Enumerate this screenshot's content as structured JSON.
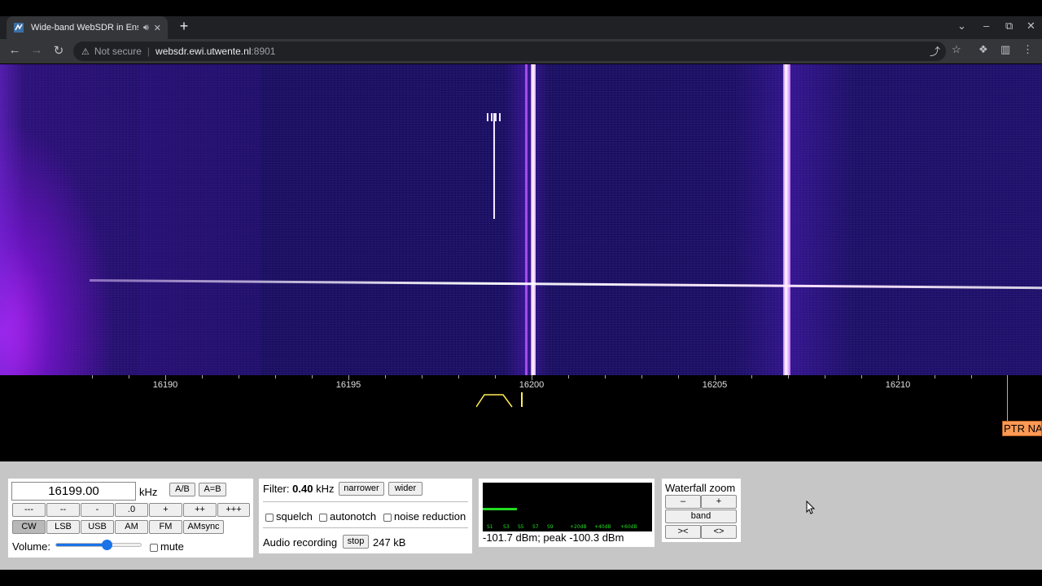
{
  "browser": {
    "tab_title": "Wide-band WebSDR in Ensch",
    "new_tab_label": "+",
    "security_label": "Not secure",
    "url_host": "websdr.ewi.utwente.nl",
    "url_port": ":8901"
  },
  "scale": {
    "labels": [
      {
        "text": "16190",
        "khz": 16190
      },
      {
        "text": "16195",
        "khz": 16195
      },
      {
        "text": "16200",
        "khz": 16200
      },
      {
        "text": "16205",
        "khz": 16205
      },
      {
        "text": "16210",
        "khz": 16210
      }
    ],
    "marker_label": "PTR NA"
  },
  "frequency": {
    "value": "16199.00",
    "unit": "kHz",
    "ab_label": "A/B",
    "a_eq_b_label": "A=B",
    "step_buttons": [
      "---",
      "--",
      "-",
      ".0",
      "+",
      "++",
      "+++"
    ],
    "modes": [
      "CW",
      "LSB",
      "USB",
      "AM",
      "FM",
      "AMsync"
    ],
    "active_mode": "CW",
    "volume_label": "Volume:",
    "volume_level": 0.6,
    "mute_label": "mute"
  },
  "filter": {
    "label": "Filter:",
    "value": "0.40",
    "unit": "kHz",
    "narrower_label": "narrower",
    "wider_label": "wider",
    "squelch_label": "squelch",
    "autonotch_label": "autonotch",
    "noise_reduction_label": "noise reduction",
    "recording_label": "Audio recording",
    "stop_label": "stop",
    "recording_size": "247 kB"
  },
  "smeter": {
    "reading": "-101.7 dBm; peak -100.3 dBm",
    "scale_labels": [
      "S1",
      "S3",
      "S5",
      "S7",
      "S9",
      "+20dB",
      "+40dB",
      "+60dB"
    ],
    "level": 0.2
  },
  "waterfall_zoom": {
    "title": "Waterfall zoom",
    "minus_label": "–",
    "plus_label": "+",
    "band_label": "band",
    "narrow_label": "><",
    "wide_label": "<>"
  },
  "colors": {
    "waterfall_bg": "#1c0f6a",
    "signal": "#e6b8ff",
    "passband": "#ffee55",
    "marker": "#ff9a55"
  }
}
